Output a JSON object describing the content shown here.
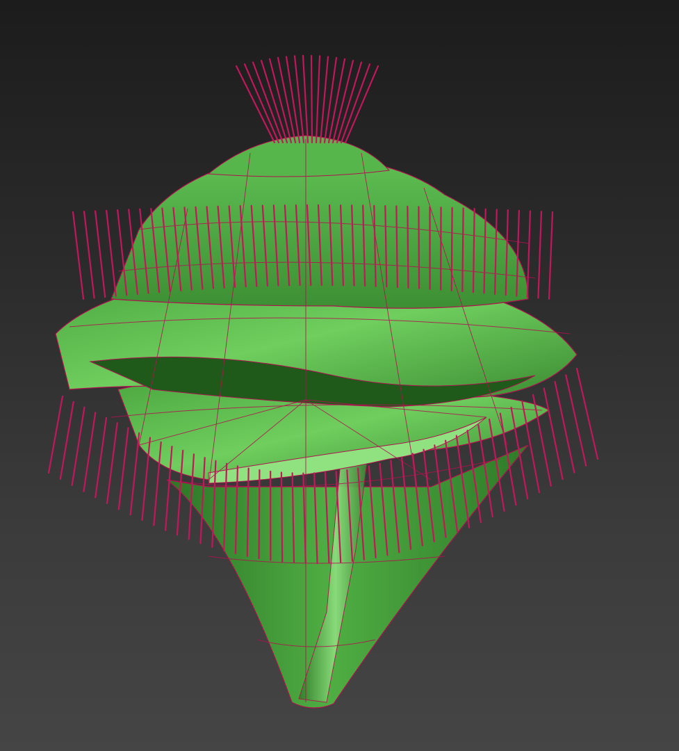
{
  "viewport": {
    "background_top": "#1c1c1c",
    "background_bottom": "#454545"
  },
  "model": {
    "shading": "green-shaded",
    "wireframe_overlay": true,
    "mesh_color": "#3f9b35",
    "mesh_highlight": "#7ed86d",
    "mesh_shadow": "#1f5a1b",
    "wire_color": "#b0124f"
  }
}
